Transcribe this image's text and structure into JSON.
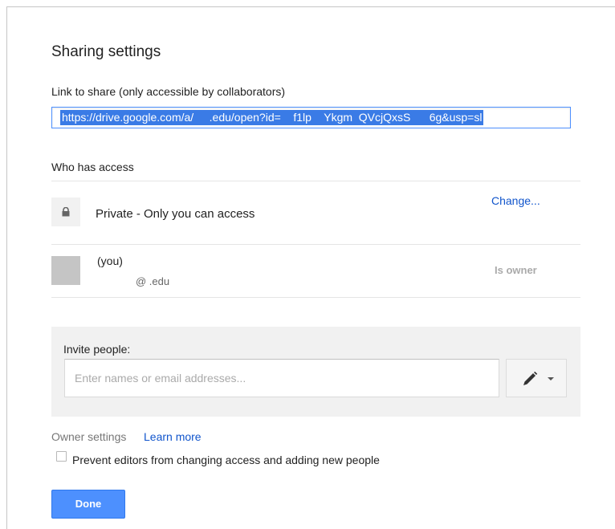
{
  "dialog": {
    "title": "Sharing settings",
    "link_label": "Link to share (only accessible by collaborators)",
    "link_value": "https://drive.google.com/a/     .edu/open?id=    f1lp    Ykgm  QVcjQxsS      6g&usp=sl"
  },
  "access": {
    "section_title": "Who has access",
    "private_label": "Private - Only you can access",
    "change_link": "Change...",
    "lock_icon": "lock-icon",
    "owner": {
      "name": "(you)",
      "email": "@  .edu",
      "role": "Is owner"
    }
  },
  "invite": {
    "label": "Invite people:",
    "placeholder": "Enter names or email addresses...",
    "permission_icon": "pencil-icon"
  },
  "owner_settings": {
    "label": "Owner settings",
    "learn_more": "Learn more",
    "checkbox_label": "Prevent editors from changing access and adding new people",
    "checkbox_checked": false
  },
  "footer": {
    "done_label": "Done"
  },
  "colors": {
    "accent": "#4d90fe",
    "link": "#1155cc",
    "selection": "#3a7be6"
  }
}
